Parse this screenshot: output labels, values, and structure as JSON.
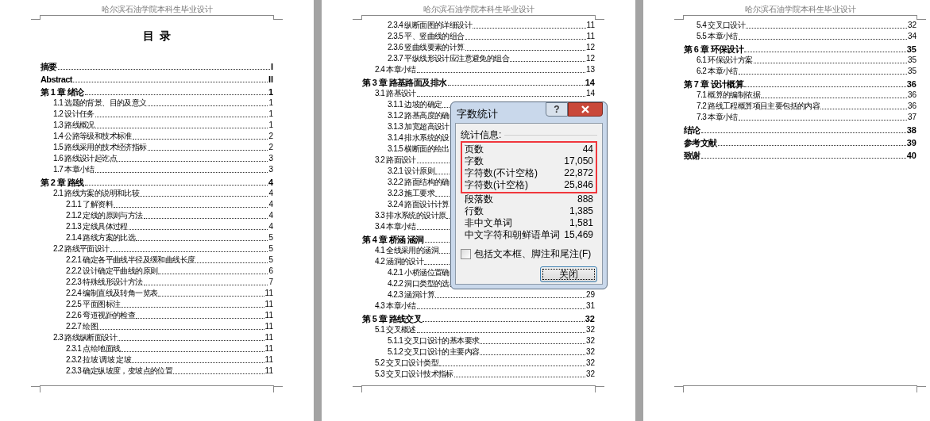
{
  "pages": [
    {
      "header": "哈尔滨石油学院本科生毕业设计",
      "title": "目  录",
      "entries": [
        {
          "kind": "chapter",
          "text": "摘要",
          "page": "I"
        },
        {
          "kind": "chapter",
          "text": "Abstract",
          "page": "II"
        },
        {
          "kind": "chapter",
          "text": "第 1 章 绪论",
          "page": "1"
        },
        {
          "kind": "section",
          "text": "1.1 选题的背景、目的及意义",
          "page": "1"
        },
        {
          "kind": "section",
          "text": "1.2 设计任务",
          "page": "1"
        },
        {
          "kind": "section",
          "text": "1.3 路线概况",
          "page": "1"
        },
        {
          "kind": "section",
          "text": "1.4 公路等级和技术标准",
          "page": "2"
        },
        {
          "kind": "section",
          "text": "1.5 路线采用的技术经济指标",
          "page": "2"
        },
        {
          "kind": "section",
          "text": "1.6 路线设计起讫点",
          "page": "3"
        },
        {
          "kind": "section",
          "text": "1.7 本章小结",
          "page": "3"
        },
        {
          "kind": "chapter",
          "text": "第 2 章 路线",
          "page": "4"
        },
        {
          "kind": "section",
          "text": "2.1 路线方案的说明和比较",
          "page": "4"
        },
        {
          "kind": "subsection",
          "text": "2.1.1 了解资料",
          "page": "4"
        },
        {
          "kind": "subsection",
          "text": "2.1.2 定线的原则与方法",
          "page": "4"
        },
        {
          "kind": "subsection",
          "text": "2.1.3 定线具体过程",
          "page": "4"
        },
        {
          "kind": "subsection",
          "text": "2.1.4 路线方案的比选",
          "page": "5"
        },
        {
          "kind": "section",
          "text": "2.2 路线平面设计",
          "page": "5"
        },
        {
          "kind": "subsection",
          "text": "2.2.1 确定各平曲线半径及缓和曲线长度",
          "page": "5"
        },
        {
          "kind": "subsection",
          "text": "2.2.2 设计确定平曲线的原则",
          "page": "6"
        },
        {
          "kind": "subsection",
          "text": "2.2.3 特殊线形设计方法",
          "page": "7"
        },
        {
          "kind": "subsection",
          "text": "2.2.4 编制直线及转角一览表",
          "page": "11"
        },
        {
          "kind": "subsection",
          "text": "2.2.5 平面图标注",
          "page": "11"
        },
        {
          "kind": "subsection",
          "text": "2.2.6 弯道视距的检查",
          "page": "11"
        },
        {
          "kind": "subsection",
          "text": "2.2.7 绘图",
          "page": "11"
        },
        {
          "kind": "section",
          "text": "2.3 路线纵断面设计",
          "page": "11"
        },
        {
          "kind": "subsection",
          "text": "2.3.1 点绘地面线",
          "page": "11"
        },
        {
          "kind": "subsection",
          "text": "2.3.2 拉坡 调坡 定坡",
          "page": "11"
        },
        {
          "kind": "subsection",
          "text": "2.3.3 确定纵坡度，变坡点的位置",
          "page": "11"
        }
      ]
    },
    {
      "header": "哈尔滨石油学院本科生毕业设计",
      "entries": [
        {
          "kind": "subsection",
          "text": "2.3.4 纵断面图的详细设计",
          "page": "11"
        },
        {
          "kind": "subsection",
          "text": "2.3.5 平、竖曲线的组合",
          "page": "11"
        },
        {
          "kind": "subsection",
          "text": "2.3.6 竖曲线要素的计算",
          "page": "12"
        },
        {
          "kind": "subsection",
          "text": "2.3.7 平纵线形设计应注意避免的组合",
          "page": "12"
        },
        {
          "kind": "section",
          "text": "2.4 本章小结",
          "page": "13"
        },
        {
          "kind": "chapter",
          "text": "第 3 章 路基路面及排水",
          "page": "14"
        },
        {
          "kind": "section",
          "text": "3.1 路基设计",
          "page": "14"
        },
        {
          "kind": "subsection",
          "text": "3.1.1 边坡的确定"
        },
        {
          "kind": "subsection",
          "text": "3.1.2 路基高度的确"
        },
        {
          "kind": "subsection",
          "text": "3.1.3 加宽超高设计"
        },
        {
          "kind": "subsection",
          "text": "3.1.4 排水系统的设"
        },
        {
          "kind": "subsection",
          "text": "3.1.5 横断面的绘出"
        },
        {
          "kind": "section",
          "text": "3.2 路面设计"
        },
        {
          "kind": "subsection",
          "text": "3.2.1 设计原则"
        },
        {
          "kind": "subsection",
          "text": "3.2.2 路面结构的确"
        },
        {
          "kind": "subsection",
          "text": "3.2.3 施工要求"
        },
        {
          "kind": "subsection",
          "text": "3.2.4 路面设计计算"
        },
        {
          "kind": "section",
          "text": "3.3 排水系统的设计原"
        },
        {
          "kind": "section",
          "text": "3.4 本章小结"
        },
        {
          "kind": "chapter",
          "text": "第 4 章 桥涵 涵洞"
        },
        {
          "kind": "section",
          "text": "4.1 全线采用的涵洞"
        },
        {
          "kind": "section",
          "text": "4.2 涵洞的设计"
        },
        {
          "kind": "subsection",
          "text": "4.2.1 小桥涵位置确"
        },
        {
          "kind": "subsection",
          "text": "4.2.2 洞口类型的选"
        },
        {
          "kind": "subsection",
          "text": "4.2.3 涵洞计算",
          "page": "29"
        },
        {
          "kind": "section",
          "text": "4.3 本章小结",
          "page": "31"
        },
        {
          "kind": "chapter",
          "text": "第 5 章 路线交叉",
          "page": "32"
        },
        {
          "kind": "section",
          "text": "5.1 交叉概述",
          "page": "32"
        },
        {
          "kind": "subsection",
          "text": "5.1.1 交叉口设计的基本要求",
          "page": "32"
        },
        {
          "kind": "subsection",
          "text": "5.1.2 交叉口设计的主要内容",
          "page": "32"
        },
        {
          "kind": "section",
          "text": "5.2 交叉口设计类型",
          "page": "32"
        },
        {
          "kind": "section",
          "text": "5.3 交叉口设计技术指标",
          "page": "32"
        }
      ]
    },
    {
      "header": "哈尔滨石油学院本科生毕业设计",
      "entries": [
        {
          "kind": "section",
          "text": "5.4 交叉口设计",
          "page": "32"
        },
        {
          "kind": "section",
          "text": "5.5 本章小结",
          "page": "34"
        },
        {
          "kind": "chapter",
          "text": "第 6 章 环保设计",
          "page": "35"
        },
        {
          "kind": "section",
          "text": "6.1 环保设计方案",
          "page": "35"
        },
        {
          "kind": "section",
          "text": "6.2 本章小结",
          "page": "35"
        },
        {
          "kind": "chapter",
          "text": "第 7 章 设计概算",
          "page": "36"
        },
        {
          "kind": "section",
          "text": "7.1 概算的编制依据",
          "page": "36"
        },
        {
          "kind": "section",
          "text": "7.2 路线工程概算项目主要包括的内容",
          "page": "36"
        },
        {
          "kind": "section",
          "text": "7.3 本章小结",
          "page": "37"
        },
        {
          "kind": "chapter",
          "text": "结论",
          "page": "38"
        },
        {
          "kind": "chapter",
          "text": "参考文献",
          "page": "39"
        },
        {
          "kind": "chapter",
          "text": "致谢",
          "page": "40"
        }
      ]
    }
  ],
  "dialog": {
    "title": "字数统计",
    "help_button": "?",
    "group_label": "统计信息:",
    "highlighted_stats": [
      {
        "label": "页数",
        "value": "44"
      },
      {
        "label": "字数",
        "value": "17,050"
      },
      {
        "label": "字符数(不计空格)",
        "value": "22,872"
      },
      {
        "label": "字符数(计空格)",
        "value": "25,846"
      }
    ],
    "other_stats": [
      {
        "label": "段落数",
        "value": "888"
      },
      {
        "label": "行数",
        "value": "1,385"
      },
      {
        "label": "非中文单词",
        "value": "1,581"
      },
      {
        "label": "中文字符和朝鲜语单词",
        "value": "15,469"
      }
    ],
    "checkbox": {
      "label": "包括文本框、脚注和尾注(F)",
      "checked": false
    },
    "close_label": "关闭"
  }
}
